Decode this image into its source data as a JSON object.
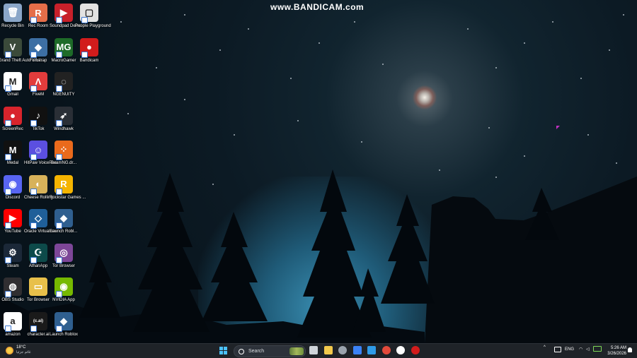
{
  "watermark": "www.BANDICAM.com",
  "desktop": {
    "icons": [
      {
        "label": "Recycle Bin",
        "icon": "recycle-bin-icon",
        "color": "#8aa6c8",
        "glyph": "🗑",
        "shortcut": false
      },
      {
        "label": "Rec Room",
        "icon": "rec-room-icon",
        "color": "#e56e49",
        "glyph": "R",
        "shortcut": true
      },
      {
        "label": "Soundpad Demo",
        "icon": "soundpad-icon",
        "color": "#c8202a",
        "glyph": "▶",
        "shortcut": true
      },
      {
        "label": "People Playground",
        "icon": "people-playground-icon",
        "color": "#e2e2e2",
        "glyph": "▢",
        "shortcut": true
      },
      {
        "label": "Grand Theft Auto V Le...",
        "icon": "gta-v-icon",
        "color": "#3b4a3a",
        "glyph": "V",
        "shortcut": true
      },
      {
        "label": "Fishstrap",
        "icon": "fishstrap-icon",
        "color": "#3d6fa3",
        "glyph": "◆",
        "shortcut": true
      },
      {
        "label": "MacroGamer",
        "icon": "macrogamer-icon",
        "color": "#1e6b28",
        "glyph": "MG",
        "shortcut": true
      },
      {
        "label": "Bandicam",
        "icon": "bandicam-icon",
        "color": "#d21c1c",
        "glyph": "●",
        "shortcut": true
      },
      {
        "label": "Gmail",
        "icon": "gmail-icon",
        "color": "#ffffff",
        "glyph": "M",
        "shortcut": true
      },
      {
        "label": "FiveM",
        "icon": "fivem-icon",
        "color": "#e23c3c",
        "glyph": "Λ",
        "shortcut": true
      },
      {
        "label": "NGENUITY",
        "icon": "ngenuity-icon",
        "color": "#222222",
        "glyph": "◌",
        "shortcut": true
      },
      {
        "label": "ScreenRec",
        "icon": "screenrec-icon",
        "color": "#d8242c",
        "glyph": "●",
        "shortcut": true
      },
      {
        "label": "TikTok",
        "icon": "tiktok-icon",
        "color": "#111111",
        "glyph": "♪",
        "shortcut": true
      },
      {
        "label": "Windhawk",
        "icon": "windhawk-icon",
        "color": "#2a2f36",
        "glyph": "➶",
        "shortcut": true
      },
      {
        "label": "Medal",
        "icon": "medal-icon",
        "color": "#111111",
        "glyph": "M",
        "shortcut": true
      },
      {
        "label": "HitPaw VoicePea",
        "icon": "hitpaw-icon",
        "color": "#5b4fe0",
        "glyph": "☺",
        "shortcut": true
      },
      {
        "label": "BeamNG.dr...",
        "icon": "beamng-icon",
        "color": "#ea6a1c",
        "glyph": "⁘",
        "shortcut": true
      },
      {
        "label": "Discord",
        "icon": "discord-icon",
        "color": "#5865f2",
        "glyph": "◉",
        "shortcut": true
      },
      {
        "label": "Cheese Rolling",
        "icon": "cheese-rolling-icon",
        "color": "#d7b25a",
        "glyph": "◐",
        "shortcut": true
      },
      {
        "label": "Rockstar Games ...",
        "icon": "rockstar-icon",
        "color": "#f5b400",
        "glyph": "R",
        "shortcut": true
      },
      {
        "label": "YouTube",
        "icon": "youtube-icon",
        "color": "#ff0000",
        "glyph": "▶",
        "shortcut": true
      },
      {
        "label": "Oracle VirtualBox",
        "icon": "virtualbox-icon",
        "color": "#1f5f99",
        "glyph": "◇",
        "shortcut": true
      },
      {
        "label": "Launch Robl...",
        "icon": "roblox-launch-icon",
        "color": "#2f5f8f",
        "glyph": "◆",
        "shortcut": true
      },
      {
        "label": "Steam",
        "icon": "steam-icon",
        "color": "#1b2838",
        "glyph": "⚙",
        "shortcut": true
      },
      {
        "label": "AthanApp",
        "icon": "athanapp-icon",
        "color": "#0d4a4a",
        "glyph": "☪",
        "shortcut": true
      },
      {
        "label": "Tor Browser",
        "icon": "tor-browser-icon",
        "color": "#7d4698",
        "glyph": "◎",
        "shortcut": true
      },
      {
        "label": "OBS Studio",
        "icon": "obs-icon",
        "color": "#302e31",
        "glyph": "◍",
        "shortcut": true
      },
      {
        "label": "Tor Browser",
        "icon": "folder-icon",
        "color": "#e8c04a",
        "glyph": "▭",
        "shortcut": false
      },
      {
        "label": "NVIDIA App",
        "icon": "nvidia-icon",
        "color": "#76b900",
        "glyph": "◉",
        "shortcut": true
      },
      {
        "label": "amazon",
        "icon": "amazon-icon",
        "color": "#ffffff",
        "glyph": "a",
        "shortcut": true
      },
      {
        "label": "character.ai",
        "icon": "character-ai-icon",
        "color": "#1a1a1a",
        "glyph": "(c.ai)",
        "shortcut": true
      },
      {
        "label": "Launch Roblox",
        "icon": "roblox-icon",
        "color": "#2f5f8f",
        "glyph": "◆",
        "shortcut": true
      }
    ]
  },
  "taskbar": {
    "weather_temp": "18°C",
    "weather_condition": "غائم جزئيا",
    "search_label": "Search",
    "apps": [
      {
        "name": "task-view-icon",
        "color": "#cfd4da"
      },
      {
        "name": "file-explorer-icon",
        "color": "#f2c94c"
      },
      {
        "name": "app-circle-icon",
        "color": "#9aa3ad"
      },
      {
        "name": "app-blue-icon",
        "color": "#3b82f6"
      },
      {
        "name": "app-photos-icon",
        "color": "#2f9be8"
      },
      {
        "name": "chrome-icon",
        "color": "#e24a3b"
      },
      {
        "name": "soundpad-taskbar-icon",
        "color": "#ffffff"
      },
      {
        "name": "bandicam-taskbar-icon",
        "color": "#d21c1c"
      }
    ],
    "tray": {
      "chevron": "^",
      "language": "ENG",
      "time": "5:26 AM",
      "date": "3/26/2026"
    }
  }
}
